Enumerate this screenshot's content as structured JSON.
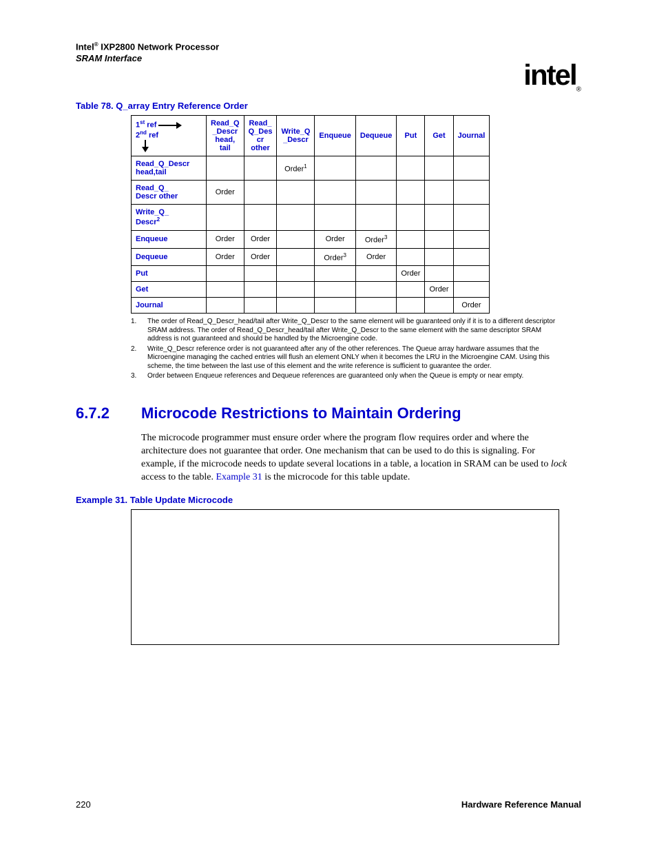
{
  "header": {
    "product_line": "Intel",
    "product_sup": "®",
    "product_rest": " IXP2800 Network Processor",
    "subtitle": "SRAM Interface",
    "logo_text": "intel",
    "logo_sub": "®"
  },
  "table": {
    "caption": "Table 78.  Q_array Entry Reference Order",
    "corner_line1a": "1",
    "corner_line1sup": "st",
    "corner_line1b": " ref",
    "corner_line2a": "2",
    "corner_line2sup": "nd",
    "corner_line2b": " ref",
    "cols": [
      "Read_Q_Descr head, tail",
      "Read_ Q_Des cr other",
      "Write_Q_Descr",
      "Enqueue",
      "Dequeue",
      "Put",
      "Get",
      "Journal"
    ],
    "rows": [
      {
        "label": "Read_Q_Descr head,tail",
        "cells": [
          "",
          "",
          "Order¹",
          "",
          "",
          "",
          "",
          ""
        ],
        "sup": ""
      },
      {
        "label": "Read_Q_ Descr other",
        "cells": [
          "Order",
          "",
          "",
          "",
          "",
          "",
          "",
          ""
        ],
        "sup": ""
      },
      {
        "label": "Write_Q_ Descr",
        "labelSup": "2",
        "cells": [
          "",
          "",
          "",
          "",
          "",
          "",
          "",
          ""
        ]
      },
      {
        "label": "Enqueue",
        "cells": [
          "Order",
          "Order",
          "",
          "Order",
          "Order³",
          "",
          "",
          ""
        ]
      },
      {
        "label": "Dequeue",
        "cells": [
          "Order",
          "Order",
          "",
          "Order³",
          "Order",
          "",
          "",
          ""
        ]
      },
      {
        "label": "Put",
        "cells": [
          "",
          "",
          "",
          "",
          "",
          "Order",
          "",
          ""
        ]
      },
      {
        "label": "Get",
        "cells": [
          "",
          "",
          "",
          "",
          "",
          "",
          "Order",
          ""
        ]
      },
      {
        "label": "Journal",
        "cells": [
          "",
          "",
          "",
          "",
          "",
          "",
          "",
          "Order"
        ]
      }
    ]
  },
  "footnotes": [
    "The order of Read_Q_Descr_head/tail after Write_Q_Descr to the same element will be guaranteed only if it is to a different descriptor SRAM address. The order of Read_Q_Descr_head/tail after Write_Q_Descr to the same element with the same descriptor SRAM address is not guaranteed and should be handled by the Microengine code.",
    "Write_Q_Descr reference order is not guaranteed after any of the other references. The Queue array hardware assumes that the Microengine managing the cached entries will flush an element ONLY when it becomes the LRU in the Microengine CAM. Using this scheme, the time between the last use of this element and the write reference is sufficient to guarantee the order.",
    "Order between Enqueue references and Dequeue references are guaranteed only when the Queue is empty or near empty."
  ],
  "section": {
    "number": "6.7.2",
    "title": "Microcode Restrictions to Maintain Ordering"
  },
  "paragraph": {
    "p1": "The microcode programmer must ensure order where the program flow requires order and where the architecture does not guarantee that order. One mechanism that can be used to do this is signaling. For example, if the microcode needs to update several locations in a table, a location in SRAM can be used to ",
    "italic": "lock",
    "p2": " access to the table. ",
    "link": "Example 31",
    "p3": " is the microcode for this table update."
  },
  "example": {
    "caption": "Example 31. Table Update Microcode"
  },
  "footer": {
    "page": "220",
    "manual": "Hardware Reference Manual"
  }
}
